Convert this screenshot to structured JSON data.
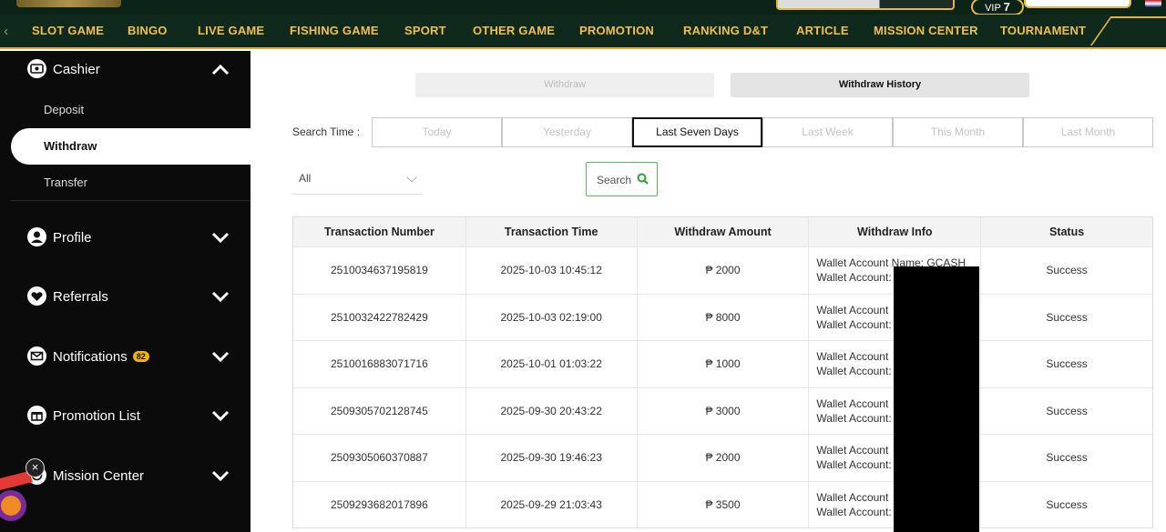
{
  "header": {
    "vip_prefix": "VIP",
    "vip_level": "7"
  },
  "nav": {
    "items": [
      "SLOT GAME",
      "BINGO",
      "LIVE GAME",
      "FISHING GAME",
      "SPORT",
      "OTHER GAME",
      "PROMOTION",
      "RANKING D&T",
      "ARTICLE",
      "MISSION CENTER",
      "TOURNAMENT"
    ],
    "active": "RANKING D&T"
  },
  "sidebar": {
    "cashier": {
      "label": "Cashier",
      "subitems": [
        "Deposit",
        "Withdraw",
        "Transfer"
      ],
      "active_subitem": "Withdraw"
    },
    "sections": [
      {
        "label": "Profile",
        "icon": "user-icon"
      },
      {
        "label": "Referrals",
        "icon": "heart-icon"
      },
      {
        "label": "Notifications",
        "icon": "envelope-icon",
        "badge": "82"
      },
      {
        "label": "Promotion List",
        "icon": "gift-icon"
      },
      {
        "label": "Mission Center",
        "icon": "target-icon"
      }
    ]
  },
  "tabs": {
    "withdraw": "Withdraw",
    "history": "Withdraw History",
    "active": "Withdraw History"
  },
  "filter": {
    "search_time_label": "Search Time :",
    "ranges": [
      "Today",
      "Yesterday",
      "Last Seven Days",
      "Last Week",
      "This Month",
      "Last Month"
    ],
    "active_range": "Last Seven Days",
    "status_select": "All",
    "search_button": "Search"
  },
  "table": {
    "columns": [
      "Transaction Number",
      "Transaction Time",
      "Withdraw Amount",
      "Withdraw Info",
      "Status"
    ],
    "rows": [
      {
        "number": "2510034637195819",
        "time": "2025-10-03 10:45:12",
        "amount": "₱ 2000",
        "info1": "Wallet Account Name: GCASH",
        "info2": "Wallet Account:",
        "status": "Success"
      },
      {
        "number": "2510032422782429",
        "time": "2025-10-03 02:19:00",
        "amount": "₱ 8000",
        "info1": "Wallet Account",
        "info2": "Wallet Account:",
        "status": "Success"
      },
      {
        "number": "2510016883071716",
        "time": "2025-10-01 01:03:22",
        "amount": "₱ 1000",
        "info1": "Wallet Account",
        "info2": "Wallet Account:",
        "status": "Success"
      },
      {
        "number": "2509305702128745",
        "time": "2025-09-30 20:43:22",
        "amount": "₱ 3000",
        "info1": "Wallet Account",
        "info2": "Wallet Account:",
        "status": "Success"
      },
      {
        "number": "2509305060370887",
        "time": "2025-09-30 19:46:23",
        "amount": "₱ 2000",
        "info1": "Wallet Account",
        "info2": "Wallet Account:",
        "status": "Success"
      },
      {
        "number": "2509293682017896",
        "time": "2025-09-29 21:03:43",
        "amount": "₱ 3500",
        "info1": "Wallet Account",
        "info2": "Wallet Account:",
        "status": "Success"
      }
    ]
  },
  "colors": {
    "nav_bg": "#0f2a1d",
    "nav_text": "#f0c04a",
    "sidebar_bg": "#0b0b0b",
    "success_border": "#5cb85c"
  }
}
